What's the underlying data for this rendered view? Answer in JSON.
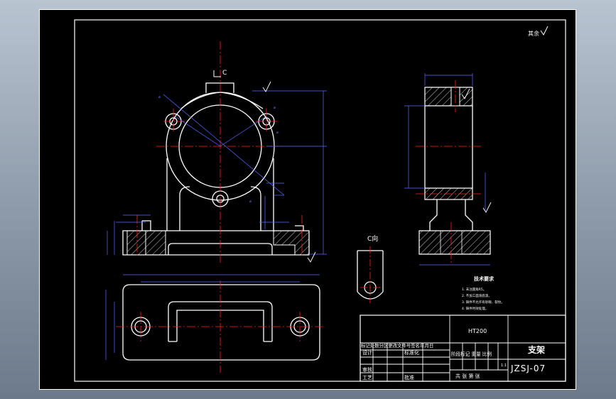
{
  "surface_finish": "其余",
  "section_label": "C",
  "view_label": "C向",
  "tech_requirements": {
    "title": "技术要求",
    "items": [
      "1. 未注圆角R5。",
      "2. 不加工面涂底漆。",
      "3. 铸件不允许有砂眼、裂纹。",
      "4. 铸件时效处理。"
    ]
  },
  "title_block": {
    "material": "HT200",
    "part_name": "支架",
    "drawing_number": "JZSJ-07",
    "header_row": "标记处数分区更改文件号签名年月日",
    "design": "设计",
    "standardize": "标准化",
    "stage_labels": "阶段标记 重量 比例",
    "scale": "1:1",
    "review": "审核",
    "process": "工艺",
    "approve": "批准",
    "sheet_info": "共 张 第 张"
  },
  "colors": {
    "background": "#000000",
    "outline": "#ffffff",
    "center_line": "#ff2020",
    "dimension": "#5a6cff"
  }
}
